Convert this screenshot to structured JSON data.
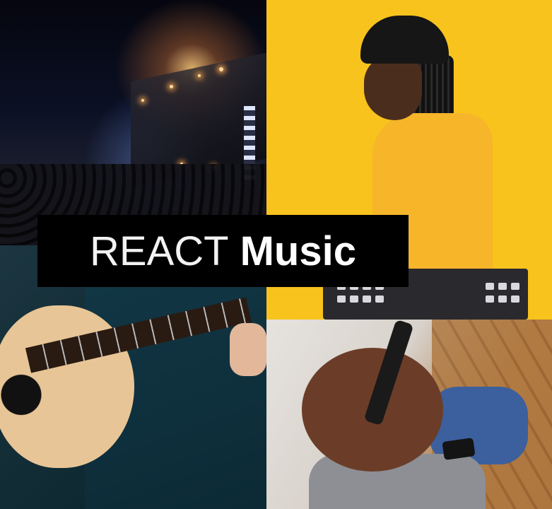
{
  "brand": {
    "title_light": "REACT",
    "title_bold": "Music"
  },
  "colors": {
    "banner_background": "#000000",
    "banner_text": "#ffffff",
    "yellow_panel": "#f8c31d"
  },
  "tiles": [
    {
      "name": "concert"
    },
    {
      "name": "yellow-musician"
    },
    {
      "name": "guitarist"
    },
    {
      "name": "headphone-listener"
    }
  ]
}
